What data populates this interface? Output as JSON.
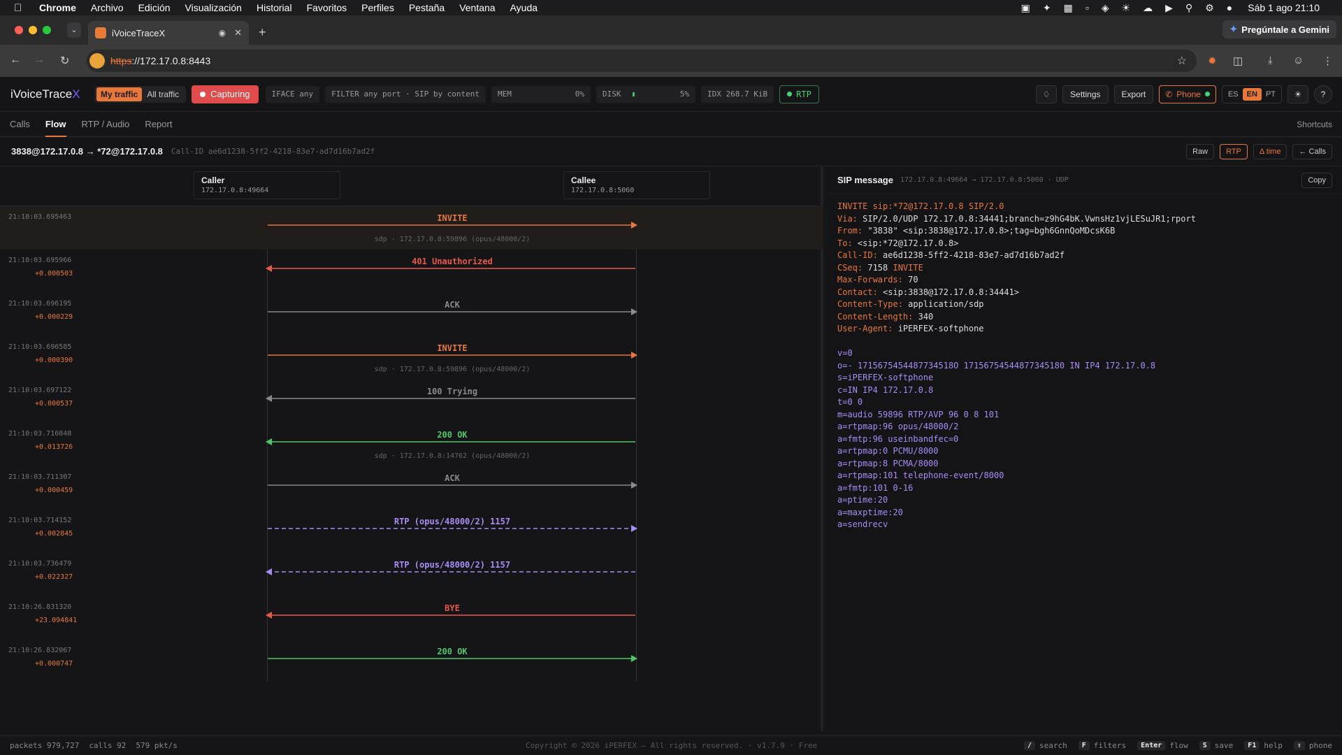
{
  "menubar": {
    "app": "Chrome",
    "items": [
      "Archivo",
      "Edición",
      "Visualización",
      "Historial",
      "Favoritos",
      "Perfiles",
      "Pestaña",
      "Ventana",
      "Ayuda"
    ],
    "clock": "Sáb 1 ago  21:10"
  },
  "browser": {
    "tab_title": "iVoiceTraceX",
    "url_scheme": "https",
    "url_rest": "://172.17.0.8:8443",
    "gemini": "Pregúntale a Gemini"
  },
  "app": {
    "logo": "iVoiceTrace",
    "logo_x": "X",
    "traffic_my": "My traffic",
    "traffic_all": "All traffic",
    "capturing": "Capturing",
    "iface": "IFACE any",
    "filter": "FILTER any port · SIP by content",
    "mem_label": "MEM",
    "mem_value": "0%",
    "disk_label": "DISK",
    "disk_value": "5%",
    "idx": "IDX 268.7 KiB",
    "rtp": "RTP",
    "settings": "Settings",
    "export": "Export",
    "phone": "Phone",
    "langs": [
      "ES",
      "EN",
      "PT"
    ],
    "tabs": [
      "Calls",
      "Flow",
      "RTP / Audio",
      "Report"
    ],
    "shortcuts": "Shortcuts"
  },
  "call": {
    "title": "3838@172.17.0.8 → *72@172.17.0.8",
    "call_id": "Call-ID ae6d1238-5ff2-4218-83e7-ad7d16b7ad2f",
    "actions": {
      "raw": "Raw",
      "rtp": "RTP",
      "delta": "Δ time",
      "calls": "← Calls"
    }
  },
  "actors": {
    "caller": {
      "name": "Caller",
      "ip": "172.17.0.8:49664"
    },
    "callee": {
      "name": "Callee",
      "ip": "172.17.0.8:5060"
    }
  },
  "flow": [
    {
      "ts": "21:10:03.695463",
      "delta": "",
      "label": "INVITE",
      "sdp": "sdp · 172.17.0.8:59896 (opus/48000/2)",
      "dir": "right",
      "color": "#e8773a",
      "dashed": false
    },
    {
      "ts": "21:10:03.695966",
      "delta": "+0.000503",
      "label": "401 Unauthorized",
      "sdp": "",
      "dir": "left",
      "color": "#e8584a",
      "dashed": false
    },
    {
      "ts": "21:10:03.696195",
      "delta": "+0.000229",
      "label": "ACK",
      "sdp": "",
      "dir": "right",
      "color": "#8a8a8a",
      "dashed": false
    },
    {
      "ts": "21:10:03.696585",
      "delta": "+0.000390",
      "label": "INVITE",
      "sdp": "sdp · 172.17.0.8:59896 (opus/48000/2)",
      "dir": "right",
      "color": "#e8773a",
      "dashed": false
    },
    {
      "ts": "21:10:03.697122",
      "delta": "+0.000537",
      "label": "100 Trying",
      "sdp": "",
      "dir": "left",
      "color": "#8a8a8a",
      "dashed": false
    },
    {
      "ts": "21:10:03.710848",
      "delta": "+0.013726",
      "label": "200 OK",
      "sdp": "sdp · 172.17.0.8:14762 (opus/48000/2)",
      "dir": "left",
      "color": "#4cc86a",
      "dashed": false
    },
    {
      "ts": "21:10:03.711307",
      "delta": "+0.000459",
      "label": "ACK",
      "sdp": "",
      "dir": "right",
      "color": "#8a8a8a",
      "dashed": false
    },
    {
      "ts": "21:10:03.714152",
      "delta": "+0.002845",
      "label": "RTP (opus/48000/2) 1157",
      "sdp": "",
      "dir": "right",
      "color": "#a98cf5",
      "dashed": true
    },
    {
      "ts": "21:10:03.736479",
      "delta": "+0.022327",
      "label": "RTP (opus/48000/2) 1157",
      "sdp": "",
      "dir": "left",
      "color": "#a98cf5",
      "dashed": true
    },
    {
      "ts": "21:10:26.831320",
      "delta": "+23.094841",
      "label": "BYE",
      "sdp": "",
      "dir": "left",
      "color": "#e8584a",
      "dashed": false
    },
    {
      "ts": "21:10:26.832067",
      "delta": "+0.000747",
      "label": "200 OK",
      "sdp": "",
      "dir": "right",
      "color": "#4cc86a",
      "dashed": false
    }
  ],
  "sip": {
    "title": "SIP message",
    "meta": "172.17.0.8:49664 → 172.17.0.8:5060 · UDP",
    "copy": "Copy",
    "lines": [
      {
        "k": "start",
        "t": "INVITE sip:*72@172.17.0.8 SIP/2.0"
      },
      {
        "k": "h",
        "n": "Via:",
        "v": " SIP/2.0/UDP 172.17.0.8:34441;branch=z9hG4bK.VwnsHz1vjLESuJR1;rport"
      },
      {
        "k": "h",
        "n": "From:",
        "v": " \"3838\" <sip:3838@172.17.0.8>;tag=bgh6GnnQoMDcsK6B"
      },
      {
        "k": "h",
        "n": "To:",
        "v": " <sip:*72@172.17.0.8>"
      },
      {
        "k": "h",
        "n": "Call-ID:",
        "v": " ae6d1238-5ff2-4218-83e7-ad7d16b7ad2f"
      },
      {
        "k": "h",
        "n": "CSeq:",
        "v": " 7158 ",
        "v2": "INVITE"
      },
      {
        "k": "h",
        "n": "Max-Forwards:",
        "v": " 70"
      },
      {
        "k": "h",
        "n": "Contact:",
        "v": " <sip:3838@172.17.0.8:34441>"
      },
      {
        "k": "h",
        "n": "Content-Type:",
        "v": " application/sdp"
      },
      {
        "k": "h",
        "n": "Content-Length:",
        "v": " 340"
      },
      {
        "k": "h",
        "n": "User-Agent:",
        "v": " iPERFEX-softphone"
      },
      {
        "k": "blank",
        "t": ""
      },
      {
        "k": "sdp",
        "t": "v=0"
      },
      {
        "k": "sdp",
        "t": "o=- 1715675454487734518O 17156754544877345180 IN IP4 172.17.0.8"
      },
      {
        "k": "sdp",
        "t": "s=iPERFEX-softphone"
      },
      {
        "k": "sdp",
        "t": "c=IN IP4 172.17.0.8"
      },
      {
        "k": "sdp",
        "t": "t=0 0"
      },
      {
        "k": "sdp",
        "t": "m=audio 59896 RTP/AVP 96 0 8 101"
      },
      {
        "k": "sdp",
        "t": "a=rtpmap:96 opus/48000/2"
      },
      {
        "k": "sdp",
        "t": "a=fmtp:96 useinbandfec=0"
      },
      {
        "k": "sdp",
        "t": "a=rtpmap:0 PCMU/8000"
      },
      {
        "k": "sdp",
        "t": "a=rtpmap:8 PCMA/8000"
      },
      {
        "k": "sdp",
        "t": "a=rtpmap:101 telephone-event/8000"
      },
      {
        "k": "sdp",
        "t": "a=fmtp:101 0-16"
      },
      {
        "k": "sdp",
        "t": "a=ptime:20"
      },
      {
        "k": "sdp",
        "t": "a=maxptime:20"
      },
      {
        "k": "sdp",
        "t": "a=sendrecv"
      }
    ]
  },
  "footer": {
    "packets": "packets 979,727",
    "calls": "calls 92",
    "rate": "579 pkt/s",
    "copyright": "Copyright © 2026 iPERFEX — All rights reserved. · v1.7.9 · Free",
    "keys": [
      {
        "k": "/",
        "l": "search"
      },
      {
        "k": "F",
        "l": "filters"
      },
      {
        "k": "Enter",
        "l": "flow"
      },
      {
        "k": "S",
        "l": "save"
      },
      {
        "k": "F1",
        "l": "help"
      },
      {
        "k": "⇧",
        "l": "phone"
      }
    ]
  },
  "colors": {
    "accent": "#e8773a",
    "capture": "#e04b4b",
    "ok": "#4cc86a",
    "rtp": "#a98cf5"
  }
}
